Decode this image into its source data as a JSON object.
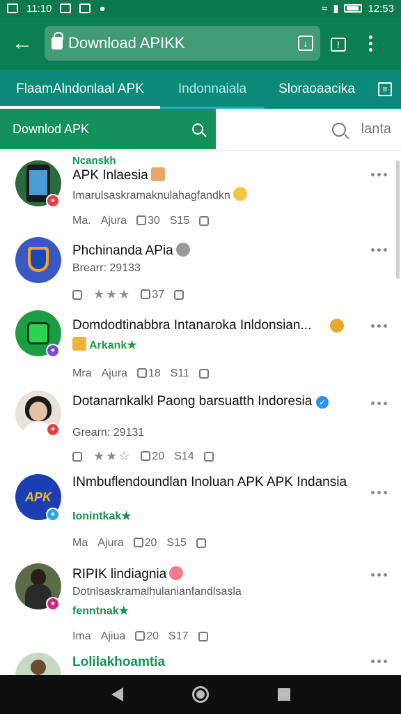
{
  "status_bar": {
    "time_left": "11:10",
    "time_right": "12:53"
  },
  "toolbar": {
    "url_text": "Download APIKK"
  },
  "tabs": [
    {
      "label": "FlaamAlndonlaal APK"
    },
    {
      "label": "Indonnaiala"
    },
    {
      "label": "Sloraoaacika"
    }
  ],
  "search": {
    "chip_label": "Downlod APK",
    "right_text": "lanta"
  },
  "items": [
    {
      "overline": "Ncanskh",
      "title": "APK Inlaesia",
      "subtitle": "Imarulsaskramaknulahagfandkn",
      "meta": [
        "Ma.",
        "Ajura",
        "30",
        "S15"
      ],
      "accent": "#1f7a4a"
    },
    {
      "title": "Phchinanda APia",
      "subtitle": "Brearr: 29133",
      "meta": [
        "★★★",
        "37"
      ],
      "stars": "★★★"
    },
    {
      "title": "Domdodtinabbra Intanaroka Inldonsian...",
      "subtitle": "Arkank★",
      "meta": [
        "Mra",
        "Ajura",
        "18",
        "S11"
      ]
    },
    {
      "title": "Dotanarnkalkl Paong barsuatth Indoresia",
      "subtitle": "Grearn: 29131",
      "meta": [
        "★★☆",
        "20",
        "S14"
      ]
    },
    {
      "title": "INmbuflendoundlan Inoluan APK APK Indansia",
      "subtitle": "Ionintkak★",
      "meta": [
        "Ma",
        "Ajura",
        "20",
        "S15"
      ]
    },
    {
      "title": "RIPIK lindiagnia",
      "subtitle": "Dotnlsaskramalhulanianfandlsasla",
      "tag": "fenntnak★",
      "meta": [
        "Ima",
        "Ajiua",
        "20",
        "S17"
      ]
    },
    {
      "title": "Lolilakhoamtia",
      "subtitle": ""
    }
  ]
}
